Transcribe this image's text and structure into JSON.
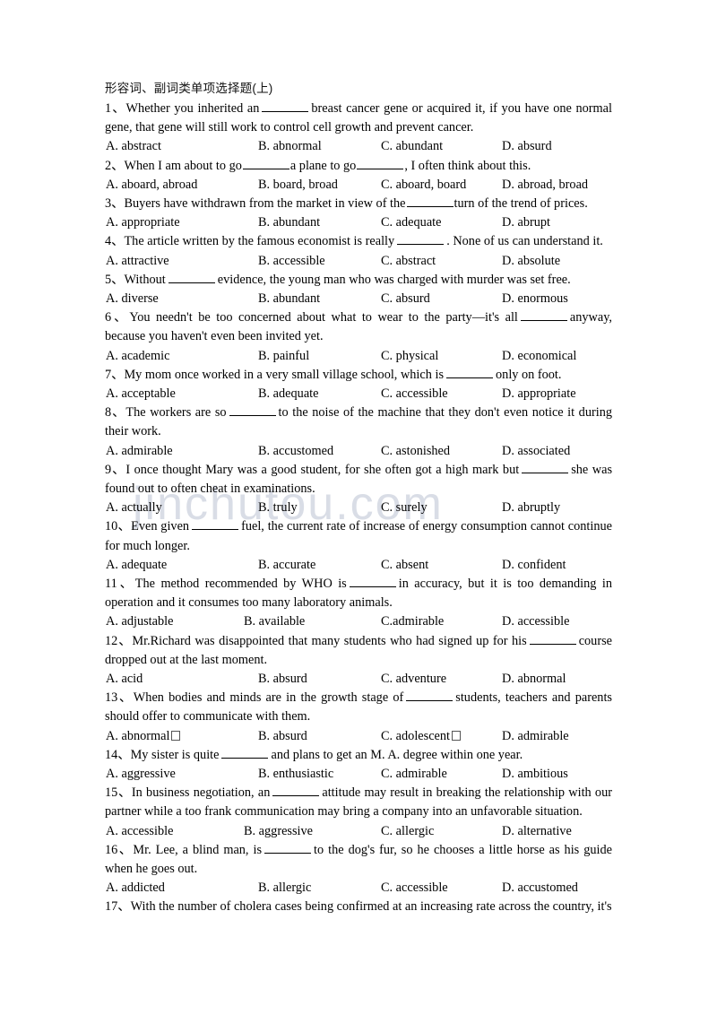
{
  "document": {
    "title": "形容词、副词类单项选择题(上)",
    "watermark": "jinchutou.com",
    "watermark_color": "#d9dde6"
  },
  "questions": [
    {
      "number": "1、",
      "stem_before": "Whether you inherited an",
      "stem_after": "breast cancer gene or acquired it, if you have one normal gene, that gene will still work to control cell growth and prevent cancer.",
      "options": [
        "A. abstract",
        "B. abnormal",
        "C. abundant",
        "D. absurd"
      ]
    },
    {
      "number": "2、",
      "stem_before": "When I am about to go",
      "stem_mid": "a plane to go",
      "stem_after": ", I often think about this.",
      "options": [
        "A. aboard, abroad",
        "B. board, broad",
        "C. aboard, board",
        "D. abroad, broad"
      ]
    },
    {
      "number": "3、",
      "stem_before": "Buyers have withdrawn from the market in view of the",
      "stem_after": "turn of the trend of prices.",
      "options": [
        "A. appropriate",
        "B. abundant",
        "C. adequate",
        "D. abrupt"
      ]
    },
    {
      "number": "4、",
      "stem_before": "The article written by the famous economist is really",
      "stem_after": ". None of us can understand it.",
      "options": [
        "A. attractive",
        "B. accessible",
        "C. abstract",
        "D. absolute"
      ]
    },
    {
      "number": "5、",
      "stem_before": "Without",
      "stem_after": "evidence, the young man who was charged with murder was set free.",
      "options": [
        "A. diverse",
        "B. abundant",
        "C. absurd",
        "D. enormous"
      ]
    },
    {
      "number": "6、",
      "stem_before": "You needn't be too concerned about what to wear to the party—it's all",
      "stem_after": "anyway, because you haven't even been invited yet.",
      "options": [
        "A. academic",
        "B. painful",
        "C. physical",
        "D. economical"
      ]
    },
    {
      "number": "7、",
      "stem_before": "My mom once worked in a very small village school, which is",
      "stem_after": "only on foot.",
      "options": [
        "A. acceptable",
        "B. adequate",
        "C. accessible",
        "D. appropriate"
      ]
    },
    {
      "number": "8、",
      "stem_before": "The workers are so",
      "stem_after": "to the noise of the machine that they don't even notice it during their work.",
      "options": [
        "A. admirable",
        "B. accustomed",
        "C. astonished",
        "D. associated"
      ]
    },
    {
      "number": "9、",
      "stem_before": "I once thought Mary was a good student, for she often got a high mark but",
      "stem_after": "she was found out to often cheat in examinations.",
      "options": [
        "A. actually",
        "B. truly",
        "C. surely",
        "D. abruptly"
      ]
    },
    {
      "number": "10、",
      "stem_before": "Even given",
      "stem_after": "fuel, the current rate of increase of energy consumption cannot continue for much longer.",
      "options": [
        "A. adequate",
        "B. accurate",
        "C. absent",
        "D. confident"
      ]
    },
    {
      "number": "11、",
      "stem_before": "The method recommended by WHO is",
      "stem_after": "in accuracy, but it is too demanding in operation and it consumes too many laboratory animals.",
      "options": [
        "A. adjustable",
        "B. available",
        "C.admirable",
        "D. accessible"
      ]
    },
    {
      "number": "12、",
      "stem_before": "Mr.Richard was disappointed that many students who had signed up for his",
      "stem_after": "course dropped out at the last moment.",
      "options": [
        "A. acid",
        "B. absurd",
        "C. adventure",
        "D. abnormal"
      ]
    },
    {
      "number": "13、",
      "stem_before": "When bodies and minds are in the growth stage of",
      "stem_after": "students, teachers and parents should offer to communicate with them.",
      "options": [
        "A. abnormal",
        "B. absurd",
        "C. adolescent",
        "D. admirable"
      ],
      "option_box_marks": [
        true,
        false,
        true,
        false
      ]
    },
    {
      "number": "14、",
      "stem_before": "My sister is quite",
      "stem_after": "and plans to get an M. A. degree within one year.",
      "options": [
        "A. aggressive",
        "B. enthusiastic",
        "C. admirable",
        "D. ambitious"
      ]
    },
    {
      "number": "15、",
      "stem_before": "In business negotiation, an",
      "stem_after": "attitude may result in breaking the relationship with our partner while a too frank communication may bring a company into an unfavorable situation.",
      "options": [
        "A. accessible",
        "B. aggressive",
        "C. allergic",
        "D. alternative"
      ]
    },
    {
      "number": "16、",
      "stem_before": "Mr. Lee, a blind man, is",
      "stem_after": "to the dog's fur, so he chooses a little horse as his guide when he goes out.",
      "options": [
        "A. addicted",
        "B. allergic",
        "C. accessible",
        "D. accustomed"
      ]
    },
    {
      "number": "17、",
      "stem_before": "With the number of cholera cases being confirmed at an increasing rate across the country, it's",
      "stem_after": "",
      "options": []
    }
  ]
}
